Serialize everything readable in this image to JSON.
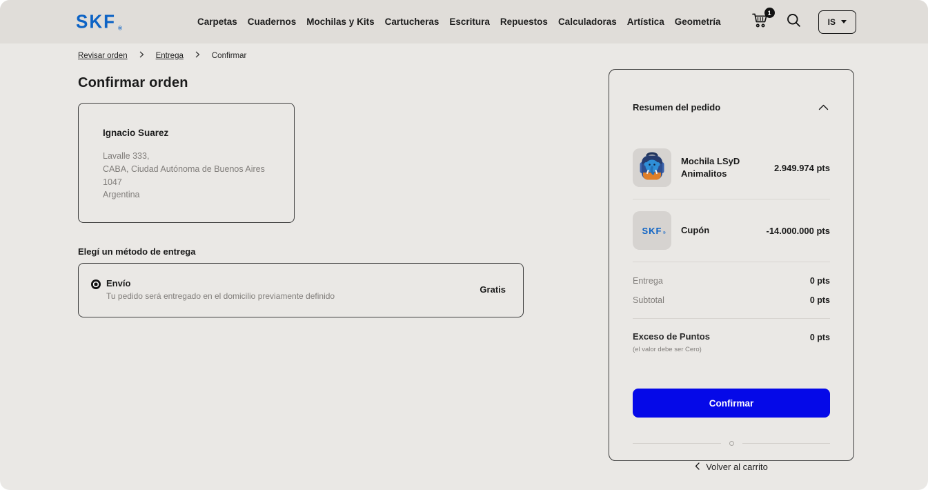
{
  "header": {
    "logo_text": "SKF",
    "logo_registered": "®",
    "nav_items": [
      "Carpetas",
      "Cuadernos",
      "Mochilas y Kits",
      "Cartucheras",
      "Escritura",
      "Repuestos",
      "Calculadoras",
      "Artística",
      "Geometría"
    ],
    "cart_badge": "1",
    "account_label": "IS"
  },
  "breadcrumb": {
    "items": [
      "Revisar orden",
      "Entrega",
      "Confirmar"
    ]
  },
  "main": {
    "title": "Confirmar orden",
    "address": {
      "name": "Ignacio Suarez",
      "line1": "Lavalle 333,",
      "line2": "CABA, Ciudad Autónoma de Buenos Aires",
      "line3": "1047",
      "line4": "Argentina"
    },
    "delivery": {
      "heading": "Elegí un método de entrega",
      "option_label": "Envío",
      "option_description": "Tu pedido será entregado en el domicilio previamente definido",
      "option_price": "Gratis"
    }
  },
  "summary": {
    "title": "Resumen del pedido",
    "items": [
      {
        "name": "Mochila LSyD Animalitos",
        "points": "2.949.974 pts",
        "thumb": "backpack"
      },
      {
        "name": "Cupón",
        "points": "-14.000.000 pts",
        "thumb": "skf-logo"
      }
    ],
    "totals": [
      {
        "label": "Entrega",
        "value": "0 pts"
      },
      {
        "label": "Subtotal",
        "value": "0 pts"
      }
    ],
    "excess": {
      "label": "Exceso de Puntos",
      "note": "(el valor debe ser Cero)",
      "value": "0 pts"
    },
    "confirm_label": "Confirmar",
    "back_label": "Volver al carrito"
  },
  "icons": {
    "cart": "cart-icon",
    "search": "search-icon",
    "caret_down": "caret-down-icon",
    "chevron_right": "chevron-right-icon",
    "chevron_up": "chevron-up-icon",
    "chevron_left": "chevron-left-icon"
  },
  "colors": {
    "accent_blue": "#0509E8",
    "logo_blue": "#0D63C5",
    "header_bg": "#E0DDD9",
    "page_bg": "#EAE8E5"
  }
}
